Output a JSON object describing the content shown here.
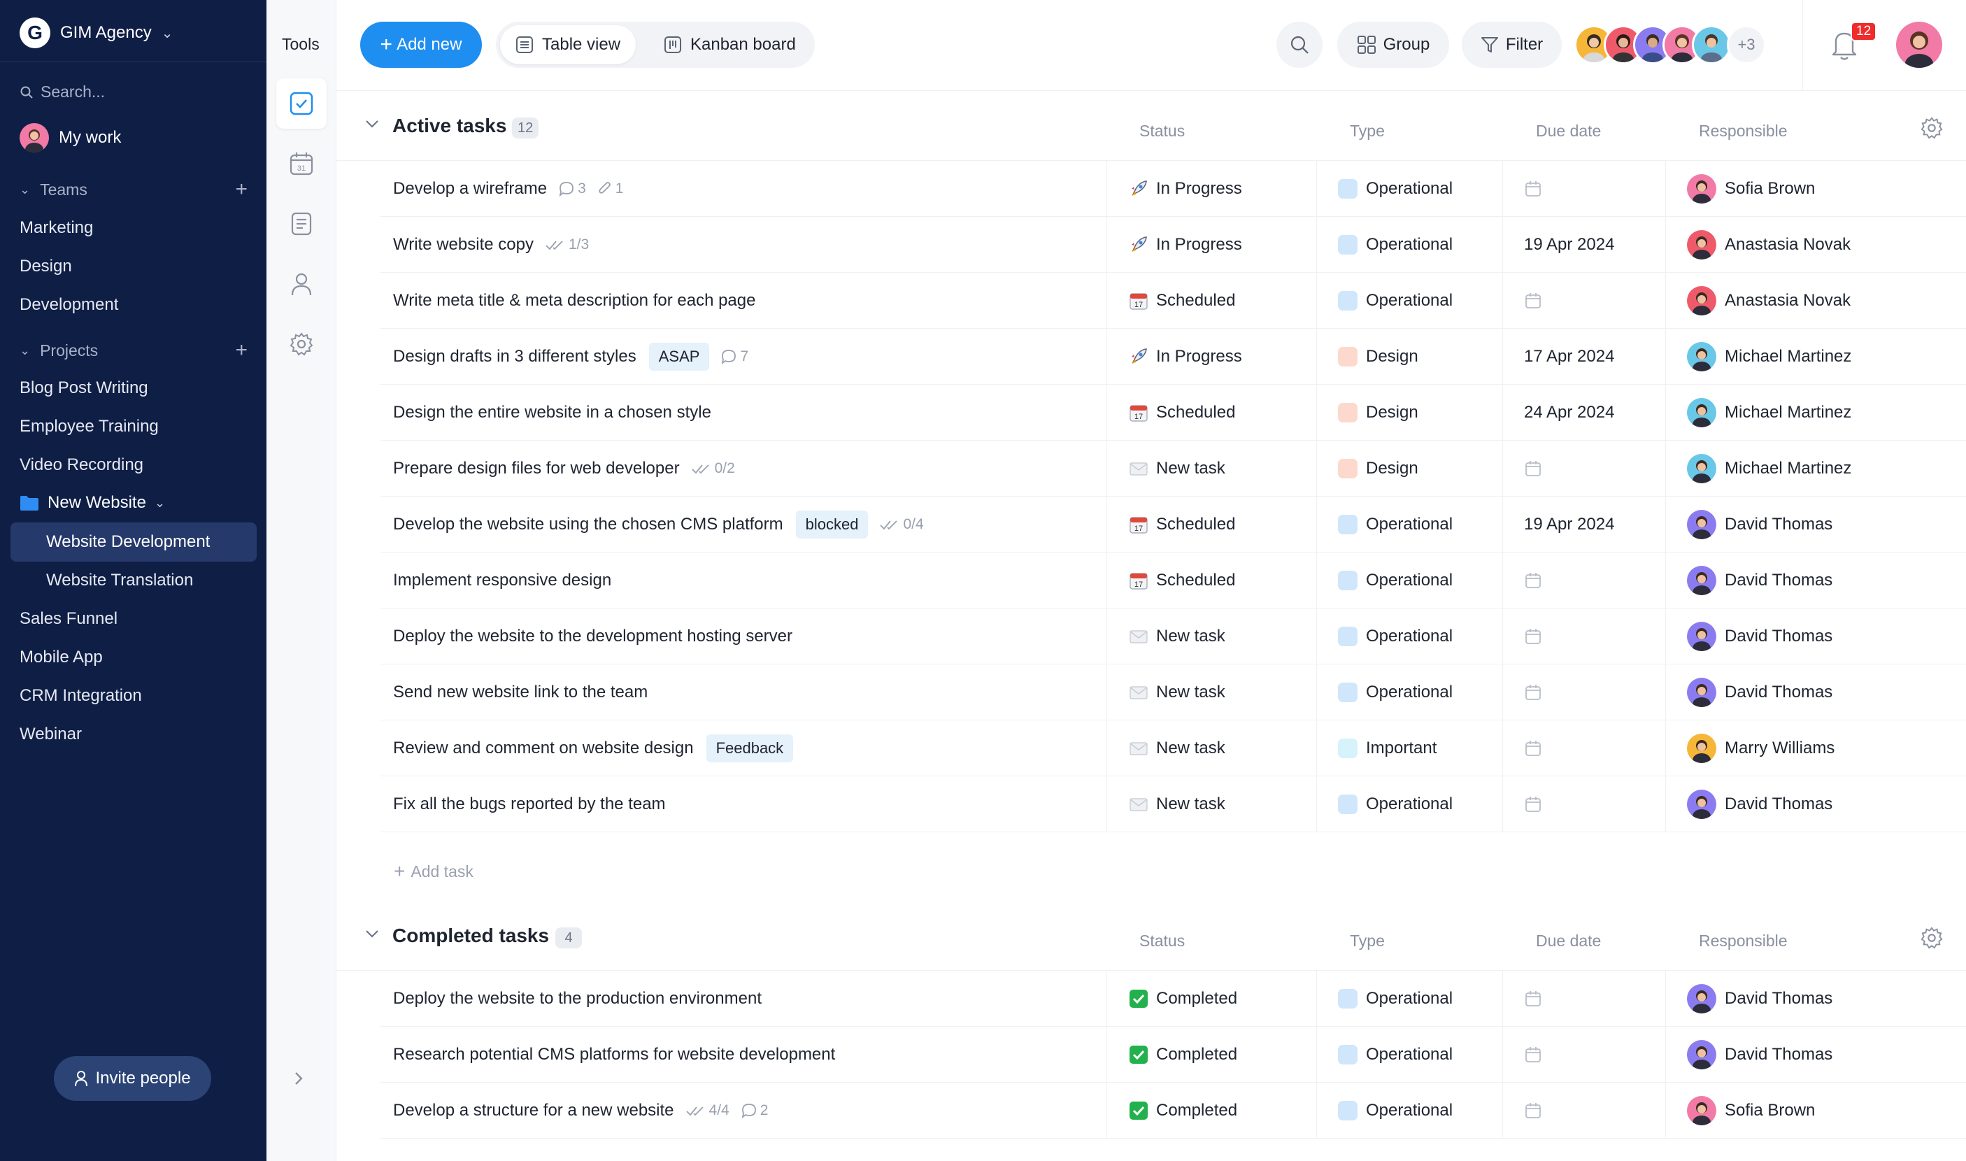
{
  "workspace": {
    "name": "GIM Agency",
    "logo_letter": "G"
  },
  "sidebar": {
    "search_placeholder": "Search...",
    "my_work": "My work",
    "teams_label": "Teams",
    "teams": [
      "Marketing",
      "Design",
      "Development"
    ],
    "projects_label": "Projects",
    "projects_before": [
      "Blog Post Writing",
      "Employee Training",
      "Video Recording"
    ],
    "folder": {
      "label": "New Website",
      "items": [
        "Website Development",
        "Website Translation"
      ],
      "active_index": 0
    },
    "projects_after": [
      "Sales Funnel",
      "Mobile App",
      "CRM Integration",
      "Webinar"
    ],
    "invite_label": "Invite people"
  },
  "tools": {
    "title": "Tools"
  },
  "toolbar": {
    "add_new": "Add new",
    "table_view": "Table view",
    "kanban_board": "Kanban board",
    "group": "Group",
    "filter": "Filter",
    "more_members": "+3",
    "notifications": "12"
  },
  "colors": {
    "sidebar_bg": "#0f1e45",
    "accent": "#1e8ef0",
    "type_operational": "#cfe6fb",
    "type_design": "#fcd9cc",
    "type_important": "#d6f2fb",
    "badge_red": "#ef2b2b"
  },
  "columns": {
    "status": "Status",
    "type": "Type",
    "due": "Due date",
    "responsible": "Responsible"
  },
  "active": {
    "title": "Active tasks",
    "count": "12",
    "add_task": "Add task",
    "rows": [
      {
        "name": "Develop a wireframe",
        "comments": "3",
        "attachments": "1",
        "status": "In Progress",
        "status_icon": "rocket",
        "type": "Operational",
        "due": "",
        "resp": "Sofia Brown"
      },
      {
        "name": "Write website copy",
        "checklist": "1/3",
        "status": "In Progress",
        "status_icon": "rocket",
        "type": "Operational",
        "due": "19 Apr 2024",
        "resp": "Anastasia Novak"
      },
      {
        "name": "Write meta title & meta description for each page",
        "status": "Scheduled",
        "status_icon": "calendar",
        "type": "Operational",
        "due": "",
        "resp": "Anastasia Novak"
      },
      {
        "name": "Design drafts in 3 different styles",
        "tag": "ASAP",
        "comments": "7",
        "status": "In Progress",
        "status_icon": "rocket",
        "type": "Design",
        "due": "17 Apr 2024",
        "resp": "Michael Martinez"
      },
      {
        "name": "Design the entire website in a chosen style",
        "status": "Scheduled",
        "status_icon": "calendar",
        "type": "Design",
        "due": "24 Apr 2024",
        "resp": "Michael Martinez"
      },
      {
        "name": "Prepare design files for web developer",
        "checklist": "0/2",
        "status": "New task",
        "status_icon": "envelope",
        "type": "Design",
        "due": "",
        "resp": "Michael Martinez"
      },
      {
        "name": "Develop the website using the chosen CMS platform",
        "tag": "blocked",
        "checklist": "0/4",
        "status": "Scheduled",
        "status_icon": "calendar",
        "type": "Operational",
        "due": "19 Apr 2024",
        "resp": "David Thomas"
      },
      {
        "name": "Implement responsive design",
        "status": "Scheduled",
        "status_icon": "calendar",
        "type": "Operational",
        "due": "",
        "resp": "David Thomas"
      },
      {
        "name": "Deploy the website to the development hosting server",
        "status": "New task",
        "status_icon": "envelope",
        "type": "Operational",
        "due": "",
        "resp": "David Thomas"
      },
      {
        "name": "Send new website link to the team",
        "status": "New task",
        "status_icon": "envelope",
        "type": "Operational",
        "due": "",
        "resp": "David Thomas"
      },
      {
        "name": "Review and comment on website design",
        "tag": "Feedback",
        "status": "New task",
        "status_icon": "envelope",
        "type": "Important",
        "due": "",
        "resp": "Marry Williams"
      },
      {
        "name": "Fix all the bugs reported by the team",
        "status": "New task",
        "status_icon": "envelope",
        "type": "Operational",
        "due": "",
        "resp": "David Thomas"
      }
    ]
  },
  "completed": {
    "title": "Completed tasks",
    "count": "4",
    "rows": [
      {
        "name": "Deploy the website to the production environment",
        "status": "Completed",
        "status_icon": "check",
        "type": "Operational",
        "due": "",
        "resp": "David Thomas"
      },
      {
        "name": "Research potential CMS platforms for website development",
        "status": "Completed",
        "status_icon": "check",
        "type": "Operational",
        "due": "",
        "resp": "David Thomas"
      },
      {
        "name": "Develop a structure for a new website",
        "checklist": "4/4",
        "comments": "2",
        "status": "Completed",
        "status_icon": "check",
        "type": "Operational",
        "due": "",
        "resp": "Sofia Brown"
      }
    ]
  }
}
